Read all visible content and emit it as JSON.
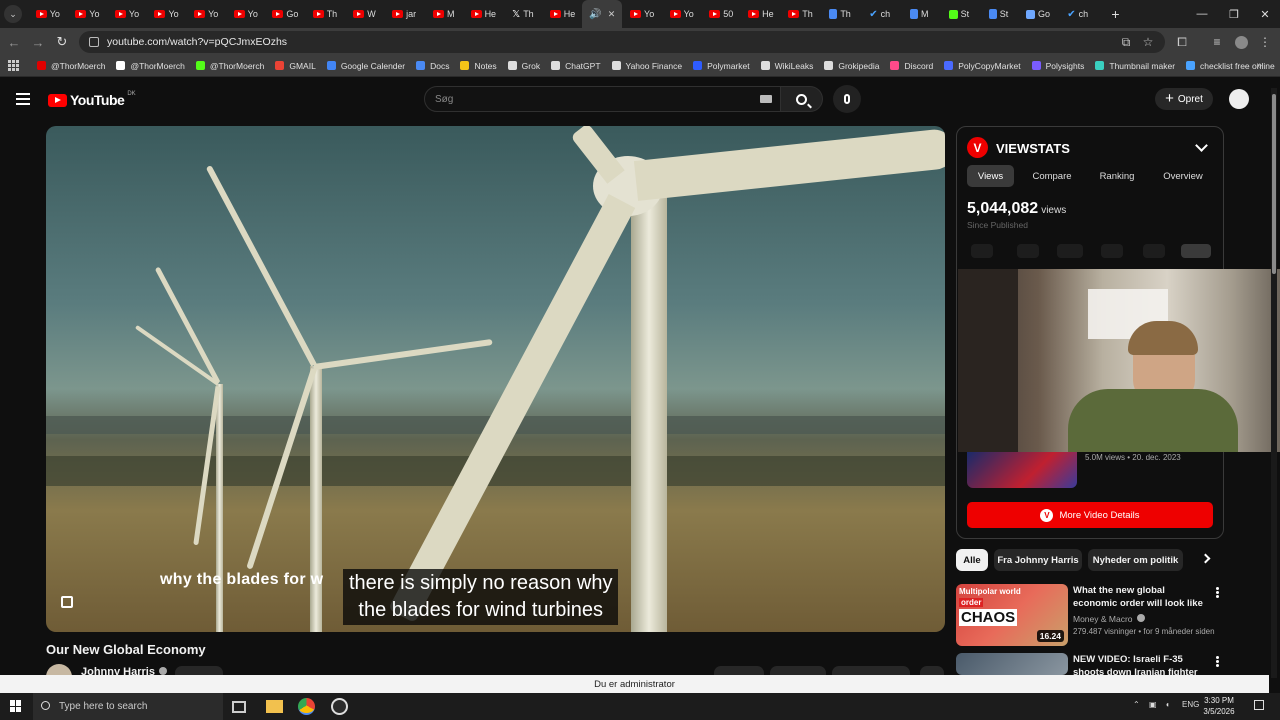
{
  "browser": {
    "tabs": [
      {
        "label": "Yo",
        "icon": "youtube-icon"
      },
      {
        "label": "Yo",
        "icon": "youtube-icon"
      },
      {
        "label": "Yo",
        "icon": "youtube-icon"
      },
      {
        "label": "Yo",
        "icon": "youtube-icon"
      },
      {
        "label": "Yo",
        "icon": "youtube-icon"
      },
      {
        "label": "Yo",
        "icon": "youtube-icon"
      },
      {
        "label": "Go",
        "icon": "youtube-icon"
      },
      {
        "label": "Th",
        "icon": "youtube-icon"
      },
      {
        "label": "W",
        "icon": "youtube-icon"
      },
      {
        "label": "jar",
        "icon": "youtube-icon"
      },
      {
        "label": "M",
        "icon": "youtube-icon"
      },
      {
        "label": "He",
        "icon": "youtube-icon"
      },
      {
        "label": "Th",
        "icon": "x-icon"
      },
      {
        "label": "He",
        "icon": "youtube-icon"
      },
      {
        "label": "",
        "icon": "speaker-icon",
        "active": true
      },
      {
        "label": "Yo",
        "icon": "youtube-icon"
      },
      {
        "label": "Yo",
        "icon": "youtube-icon"
      },
      {
        "label": "50",
        "icon": "youtube-icon"
      },
      {
        "label": "He",
        "icon": "youtube-icon"
      },
      {
        "label": "Th",
        "icon": "youtube-icon"
      },
      {
        "label": "Th",
        "icon": "docs-icon"
      },
      {
        "label": "ch",
        "icon": "check-icon"
      },
      {
        "label": "M",
        "icon": "docs-icon"
      },
      {
        "label": "St",
        "icon": "kick-icon"
      },
      {
        "label": "St",
        "icon": "docs-icon"
      },
      {
        "label": "Go",
        "icon": "page-icon"
      },
      {
        "label": "ch",
        "icon": "check-icon"
      }
    ],
    "url": "youtube.com/watch?v=pQCJmxEOzhs",
    "bookmarks": [
      {
        "label": "@ThorMoerch",
        "color": "#e00000"
      },
      {
        "label": "@ThorMoerch",
        "color": "#ffffff"
      },
      {
        "label": "@ThorMoerch",
        "color": "#53fc18"
      },
      {
        "label": "GMAIL",
        "color": "#ea4335"
      },
      {
        "label": "Google Calender",
        "color": "#4285f4"
      },
      {
        "label": "Docs",
        "color": "#4a8af4"
      },
      {
        "label": "Notes",
        "color": "#f5c518"
      },
      {
        "label": "Grok",
        "color": "#dddddd"
      },
      {
        "label": "ChatGPT",
        "color": "#dddddd"
      },
      {
        "label": "Yahoo Finance",
        "color": "#dddddd"
      },
      {
        "label": "Polymarket",
        "color": "#2e5cff"
      },
      {
        "label": "WikiLeaks",
        "color": "#dddddd"
      },
      {
        "label": "Grokipedia",
        "color": "#dddddd"
      },
      {
        "label": "Discord",
        "color": "#ff4a8a"
      },
      {
        "label": "PolyCopyMarket",
        "color": "#4a6aff"
      },
      {
        "label": "Polysights",
        "color": "#7a5cff"
      },
      {
        "label": "Thumbnail maker",
        "color": "#3ad0c0"
      },
      {
        "label": "checklist free online",
        "color": "#4aa3ff"
      }
    ]
  },
  "youtube": {
    "logo_text": "YouTube",
    "country_code": "DK",
    "search_placeholder": "Søg",
    "create_label": "Opret",
    "video": {
      "captions": {
        "ghost": "why the blades for w",
        "line1": "there is simply no reason why",
        "line2": "the blades for wind turbines"
      },
      "title": "Our New Global Economy",
      "channel": "Johnny Harris"
    },
    "viewstats": {
      "title": "VIEWSTATS",
      "tabs": [
        "Views",
        "Compare",
        "Ranking",
        "Overview"
      ],
      "active_tab": "Views",
      "views": "5,044,082",
      "views_unit": "views",
      "since": "Since Published",
      "related_meta": "5.0M views • 20. dec. 2023",
      "more_button": "More Video Details"
    },
    "chips": [
      "Alle",
      "Fra Johnny Harris",
      "Nyheder om politik"
    ],
    "recommendations": [
      {
        "title": "What the new global economic order will look like",
        "channel": "Money & Macro",
        "meta": "279.487 visninger • for 9 måneder siden",
        "duration": "16.24",
        "thumb_text": [
          "Multipolar world",
          "order",
          "CHAOS"
        ]
      },
      {
        "title": "NEW VIDEO: Israeli F-35 shoots down Iranian fighter jet over ...",
        "channel": "",
        "meta": "",
        "duration": "",
        "thumb_text": []
      }
    ]
  },
  "os": {
    "admin_notice": "Du er administrator",
    "search_placeholder": "Type here to search",
    "language": "ENG",
    "time": "3:30 PM",
    "date": "3/5/2026"
  },
  "colors": {
    "accent": "#ff0000",
    "background": "#0f0f0f",
    "viewstats_red": "#e00000"
  }
}
